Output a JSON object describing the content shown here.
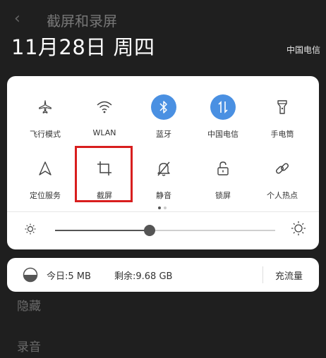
{
  "background": {
    "title": "截屏和录屏",
    "row1": "隐藏",
    "row2": "录音"
  },
  "status": {
    "date": "11月28日 周四",
    "carrier": "中国电信"
  },
  "tiles": [
    {
      "label": "飞行模式",
      "icon": "airplane-icon",
      "active": false
    },
    {
      "label": "WLAN",
      "icon": "wifi-icon",
      "active": false
    },
    {
      "label": "蓝牙",
      "icon": "bluetooth-icon",
      "active": true
    },
    {
      "label": "中国电信",
      "icon": "mobile-data-icon",
      "active": true
    },
    {
      "label": "手电筒",
      "icon": "flashlight-icon",
      "active": false
    },
    {
      "label": "定位服务",
      "icon": "location-icon",
      "active": false
    },
    {
      "label": "截屏",
      "icon": "screenshot-crop-icon",
      "active": false
    },
    {
      "label": "静音",
      "icon": "mute-bell-icon",
      "active": false
    },
    {
      "label": "锁屏",
      "icon": "lock-icon",
      "active": false
    },
    {
      "label": "个人热点",
      "icon": "hotspot-link-icon",
      "active": false
    }
  ],
  "brightness": {
    "level": 0.43
  },
  "page_indicator": {
    "pages": 2,
    "current": 1
  },
  "data_usage": {
    "today": "今日:5 MB",
    "remaining": "剩余:9.68 GB",
    "recharge": "充流量"
  },
  "colors": {
    "accent": "#4a90e2",
    "highlight": "#d81e1e"
  }
}
